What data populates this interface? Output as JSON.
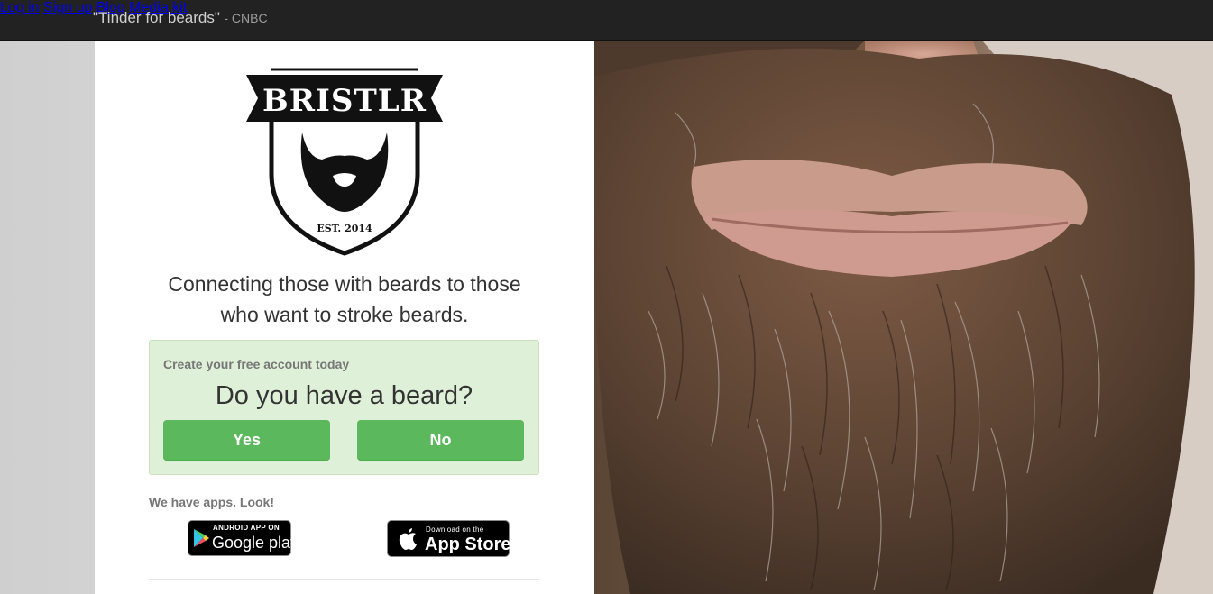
{
  "navbar": {
    "brand_quote": "\"Tinder for beards\"",
    "brand_source": "- CNBC",
    "links": [
      {
        "label": "Log in"
      },
      {
        "label": "Sign up"
      },
      {
        "label": "Blog"
      },
      {
        "label": "Media kit"
      }
    ]
  },
  "logo": {
    "name": "BRISTLR",
    "established": "EST. 2014",
    "icon": "beard-shield-icon"
  },
  "tagline": {
    "line1": "Connecting those with beards to those",
    "line2": "who want to stroke beards."
  },
  "signup": {
    "subheading": "Create your free account today",
    "question": "Do you have a beard?",
    "yes_label": "Yes",
    "no_label": "No"
  },
  "apps": {
    "label": "We have apps. Look!",
    "google": {
      "top": "ANDROID APP ON",
      "main": "Google play",
      "icon": "google-play-icon"
    },
    "apple": {
      "top": "Download on the",
      "main": "App Store",
      "icon": "apple-icon"
    }
  },
  "hero": {
    "icon": "bearded-face-photo",
    "colors": {
      "hair_dark": "#3a2a20",
      "hair_brown": "#6b4a35",
      "hair_gray": "#a9a29a",
      "skin": "#c99b8a",
      "lips": "#c48585"
    }
  },
  "colors": {
    "navbar": "#222222",
    "success_bg": "#dff0d8",
    "button": "#5cb85c"
  }
}
